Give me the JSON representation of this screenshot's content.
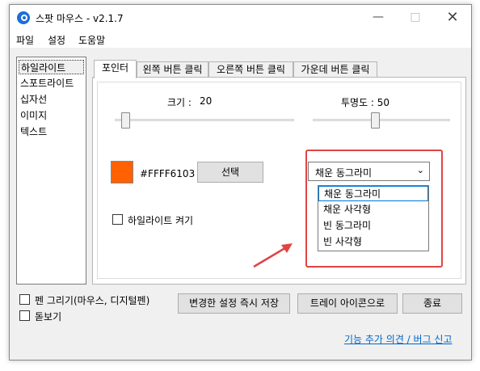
{
  "window": {
    "title": "스팟 마우스 - v2.1.7"
  },
  "menu": [
    "파일",
    "설정",
    "도움말"
  ],
  "sidebar": {
    "items": [
      {
        "label": "하일라이트",
        "selected": true
      },
      {
        "label": "스포트라이트"
      },
      {
        "label": "십자선"
      },
      {
        "label": "이미지"
      },
      {
        "label": "텍스트"
      }
    ]
  },
  "tabs": [
    {
      "label": "포인터",
      "active": true
    },
    {
      "label": "왼쪽 버튼 클릭"
    },
    {
      "label": "오른쪽 버튼 클릭"
    },
    {
      "label": "가운데 버튼 클릭"
    }
  ],
  "pointer": {
    "size_label": "크기 :",
    "size_value": "20",
    "opacity_label": "투명도 : 50",
    "size_slider_fraction": 0.04,
    "opacity_slider_fraction": 0.45,
    "color_hex": "#FFFF6103",
    "swatch_color": "#ff6103",
    "select_button": "선택",
    "highlight_checkbox": "하일라이트 켜기",
    "highlight_checked": false,
    "shape_selected": "채운 동그라미",
    "shape_options": [
      "채운 동그라미",
      "채운 사각형",
      "빈 동그라미",
      "빈 사각형"
    ],
    "annotation_color": "#e04444"
  },
  "bottom": {
    "pen_checkbox": "펜 그리기(마우스, 디지털펜)",
    "magnifier_checkbox": "돋보기",
    "save_button": "변경한 설정 즉시 저장",
    "tray_button": "트레이 아이콘으로",
    "exit_button": "종료",
    "feedback_link": "기능 추가 의견 / 버그 신고"
  }
}
